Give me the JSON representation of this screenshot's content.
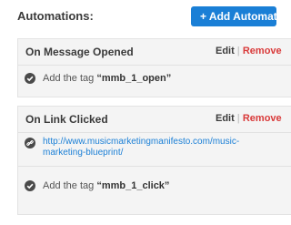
{
  "header": {
    "title": "Automations:",
    "add_button_label": "+ Add Automation"
  },
  "automations": [
    {
      "title": "On Message Opened",
      "edit_label": "Edit",
      "separator": "|",
      "remove_label": "Remove",
      "actions": [
        {
          "icon": "check-circle-icon",
          "prefix": "Add the tag ",
          "tag": "“mmb_1_open”"
        }
      ]
    },
    {
      "title": "On Link Clicked",
      "edit_label": "Edit",
      "separator": "|",
      "remove_label": "Remove",
      "link": {
        "icon": "link-icon",
        "url": "http://www.musicmarketingmanifesto.com/music-marketing-blueprint/"
      },
      "actions": [
        {
          "icon": "check-circle-icon",
          "prefix": "Add the tag ",
          "tag": "“mmb_1_click”"
        }
      ]
    }
  ],
  "colors": {
    "accent": "#1a7fd6",
    "remove": "#d93a3a",
    "card_background": "#f4f4f4",
    "icon": "#4a4a4a"
  }
}
